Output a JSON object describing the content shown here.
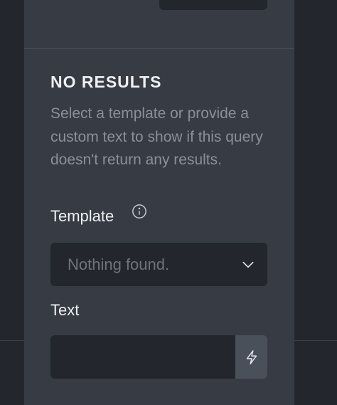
{
  "no_results": {
    "title": "NO RESULTS",
    "description": "Select a template or provide a custom text to show if this query doesn't return any results.",
    "template_label": "Template",
    "template_placeholder": "Nothing found.",
    "text_label": "Text",
    "text_value": ""
  },
  "icons": {
    "info": "info-icon",
    "chevron": "chevron-down-icon",
    "bolt": "lightning-bolt-icon"
  },
  "colors": {
    "panel": "#363b44",
    "background": "#23272d",
    "field": "#23272d",
    "title": "#eef0f3",
    "description": "#8a8f98",
    "placeholder": "#6e737c"
  }
}
